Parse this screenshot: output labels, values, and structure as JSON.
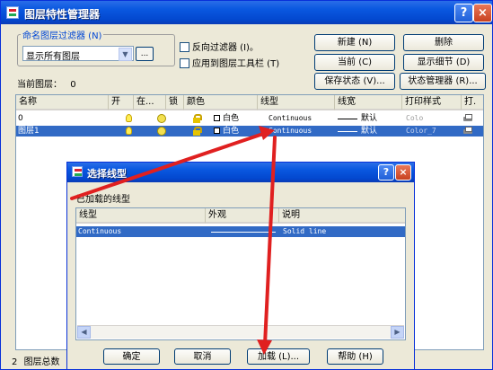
{
  "window": {
    "title": "图层特性管理器",
    "help_label": "?",
    "close_label": "×"
  },
  "filter": {
    "group_label": "命名图层过滤器 (N)",
    "selected": "显示所有图层",
    "browse_label": "...",
    "invert_label": "反向过滤器 (I)。",
    "apply_toolbar_label": "应用到图层工具栏 (T)"
  },
  "buttons": {
    "new": "新建 (N)",
    "delete": "删除",
    "current": "当前 (C)",
    "show_details": "显示细节 (D)",
    "save_state": "保存状态 (V)...",
    "state_manager": "状态管理器 (R)..."
  },
  "current_layer": {
    "label": "当前图层：",
    "value": "0"
  },
  "layer_table": {
    "headers": [
      "名称",
      "开",
      "在...",
      "锁",
      "颜色",
      "线型",
      "线宽",
      "打印样式",
      "打."
    ],
    "rows": [
      {
        "name": "0",
        "color": "白色",
        "linetype": "Continuous",
        "lineweight": "默认",
        "plot_style": "Colo",
        "selected": false
      },
      {
        "name": "图层1",
        "color": "白色",
        "linetype": "Continuous",
        "lineweight": "默认",
        "plot_style": "Color_7",
        "selected": true
      }
    ]
  },
  "status": {
    "count": "2",
    "text": "图层总数"
  },
  "dialog": {
    "title": "选择线型",
    "help_label": "?",
    "close_label": "×",
    "group_label": "已加载的线型",
    "headers": [
      "线型",
      "外观",
      "说明"
    ],
    "rows": [
      {
        "linetype": "Continuous",
        "description": "Solid line",
        "selected": true
      }
    ],
    "buttons": {
      "ok": "确定",
      "cancel": "取消",
      "load": "加载 (L)...",
      "help": "帮助 (H)"
    }
  },
  "colors": {
    "annotation_arrow": "#e02020",
    "selection": "#316ac5",
    "title_bar": "#0a58e0"
  }
}
